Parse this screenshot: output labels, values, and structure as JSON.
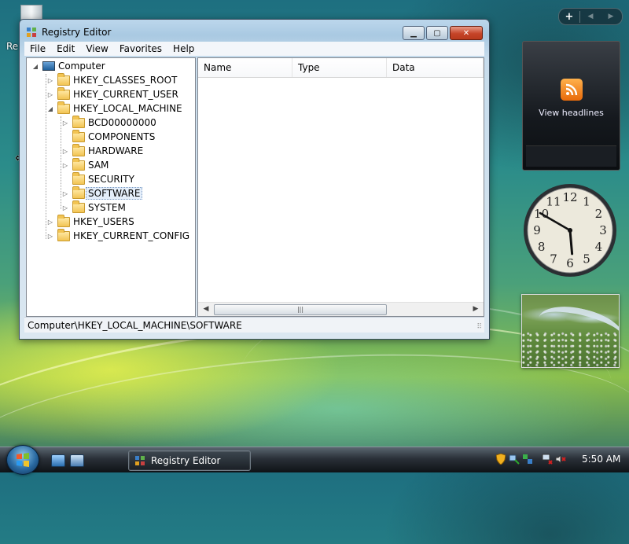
{
  "desktop": {
    "recycle_label": "Re",
    "cursor_glyph": "⟺"
  },
  "window": {
    "title": "Registry Editor",
    "caption": {
      "minimize": "▁",
      "maximize": "▢",
      "close": "✕"
    },
    "menu": [
      "File",
      "Edit",
      "View",
      "Favorites",
      "Help"
    ],
    "tree": {
      "root": "Computer",
      "hives": [
        "HKEY_CLASSES_ROOT",
        "HKEY_CURRENT_USER",
        "HKEY_LOCAL_MACHINE"
      ],
      "hklm_children": [
        "BCD00000000",
        "COMPONENTS",
        "HARDWARE",
        "SAM",
        "SECURITY",
        "SOFTWARE",
        "SYSTEM"
      ],
      "other_hives": [
        "HKEY_USERS",
        "HKEY_CURRENT_CONFIG"
      ],
      "selected": "SOFTWARE"
    },
    "list_columns": [
      "Name",
      "Type",
      "Data"
    ],
    "scroll_left": "◀",
    "scroll_right": "▶",
    "scroll_grip": "|||",
    "status_path": "Computer\\HKEY_LOCAL_MACHINE\\SOFTWARE"
  },
  "sidebar": {
    "add_label": "+",
    "nav_prev": "◀",
    "nav_next": "▶",
    "feed_text": "View headlines",
    "clock_numbers": [
      "12",
      "1",
      "2",
      "3",
      "4",
      "5",
      "6",
      "7",
      "8",
      "9",
      "10",
      "11"
    ],
    "clock_time": "5:50"
  },
  "taskbar": {
    "task_label": "Registry Editor",
    "time": "5:50 AM"
  },
  "icons": [
    "recycle-bin-icon",
    "computer-icon",
    "folder-icon",
    "rss-icon",
    "windows-logo-icon",
    "shield-icon",
    "network-icon",
    "volume-muted-icon"
  ],
  "colors": {
    "title_close": "#c54428",
    "selection": "#e4eefa",
    "taskbar": "#1a1f25"
  }
}
